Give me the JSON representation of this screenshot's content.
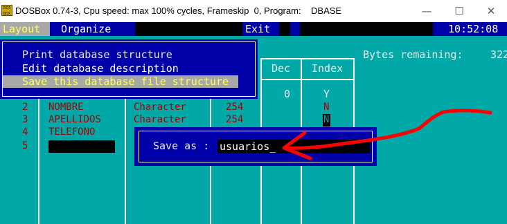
{
  "window": {
    "title": "DOSBox 0.74-3, Cpu speed: max 100% cycles, Frameskip  0, Program:    DBASE",
    "icon_text": "DOS BOX",
    "minimize": "—",
    "maximize": "☐",
    "close": "✕"
  },
  "menubar": {
    "items": [
      "Layout",
      "Organize",
      "Exit"
    ],
    "clock": "10:52:08"
  },
  "bytes_remaining": {
    "label": "Bytes remaining:",
    "value": "322"
  },
  "columns": {
    "dec": "Dec",
    "index": "Index"
  },
  "popup_menu": {
    "items": [
      "Print database structure",
      "Edit database description",
      "Save this database file structure"
    ],
    "selected_index": 2
  },
  "rows": [
    {
      "num": "2",
      "name": "NOMBRE",
      "type": "Character",
      "width": "254",
      "index": "N"
    },
    {
      "num": "3",
      "name": "APELLIDOS",
      "type": "Character",
      "width": "254",
      "index": "N"
    },
    {
      "num": "4",
      "name": "TELEFONO",
      "type": "",
      "width": "",
      "index": ""
    },
    {
      "num": "5",
      "name": "",
      "type": "",
      "width": "",
      "index": ""
    }
  ],
  "row1": {
    "dec": "0",
    "index": "Y"
  },
  "save_dialog": {
    "label": "Save as :",
    "value": "usuarios_"
  },
  "colors": {
    "dos_blue": "#0000a8",
    "dos_cyan": "#00a8a8",
    "dos_red": "#a80000",
    "highlight": "#ffff55",
    "annotation_arrow": "#ff0000"
  }
}
